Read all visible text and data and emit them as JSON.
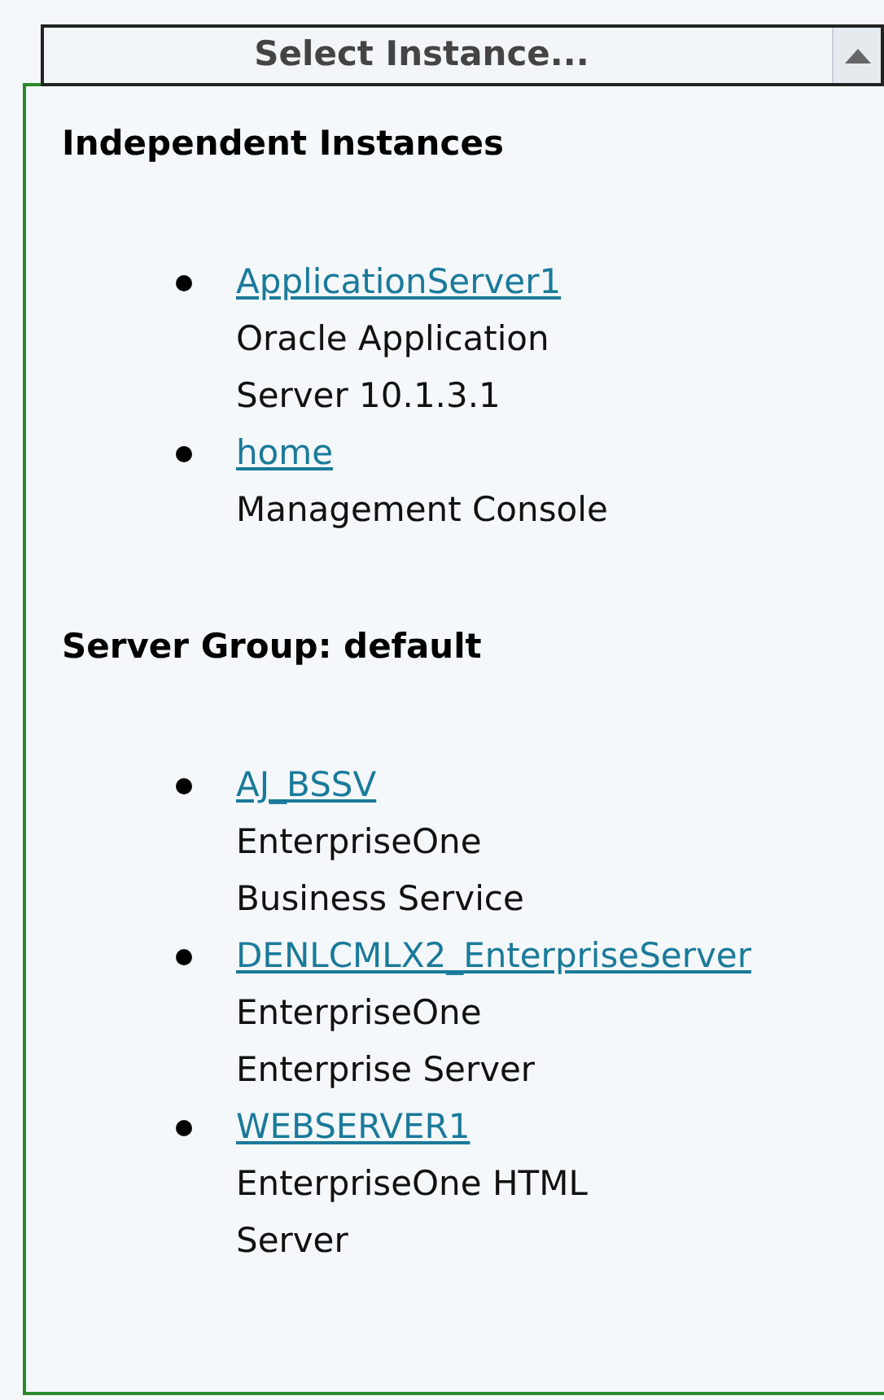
{
  "dropdown": {
    "label": "Select Instance...",
    "expanded": true
  },
  "groups": [
    {
      "heading": "Independent Instances",
      "items": [
        {
          "name": "ApplicationServer1",
          "description": "Oracle Application Server 10.1.3.1"
        },
        {
          "name": "home",
          "description": "Management Console"
        }
      ]
    },
    {
      "heading": "Server Group: default",
      "items": [
        {
          "name": "AJ_BSSV",
          "description": "EnterpriseOne Business Service"
        },
        {
          "name": "DENLCMLX2_EnterpriseServer",
          "description": "EnterpriseOne Enterprise Server"
        },
        {
          "name": "WEBSERVER1",
          "description": "EnterpriseOne HTML Server"
        }
      ]
    }
  ]
}
